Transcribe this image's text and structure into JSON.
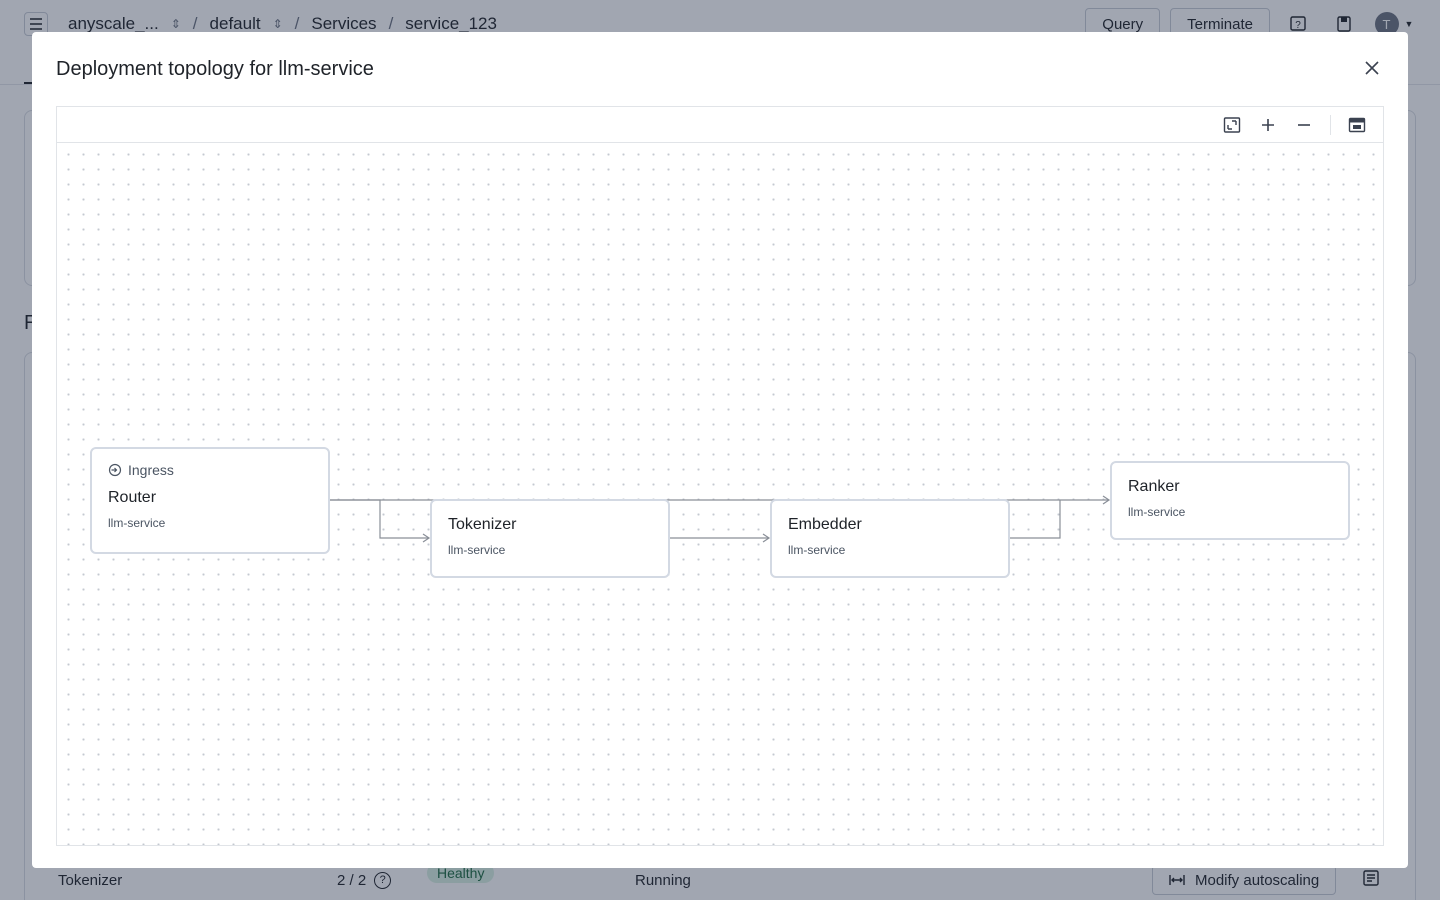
{
  "header": {
    "crumbs": [
      {
        "label": "anyscale_..."
      },
      {
        "label": "default"
      },
      {
        "label": "Services"
      },
      {
        "label": "service_123"
      }
    ],
    "query_label": "Query",
    "terminate_label": "Terminate",
    "avatar_initial": "T"
  },
  "background": {
    "section_letter": "R",
    "row": {
      "name": "Tokenizer",
      "replicas": "2 / 2",
      "help_glyph": "?",
      "health": "Healthy",
      "status": "Running",
      "autoscale_label": "Modify autoscaling"
    }
  },
  "modal": {
    "title": "Deployment topology for llm-service",
    "toolbar": {
      "icons": [
        "fit-view-icon",
        "zoom-in-icon",
        "zoom-out-icon",
        "minimap-toggle-icon"
      ]
    },
    "nodes": [
      {
        "tag": "Ingress",
        "title": "Router",
        "subtitle": "llm-service"
      },
      {
        "title": "Tokenizer",
        "subtitle": "llm-service"
      },
      {
        "title": "Embedder",
        "subtitle": "llm-service"
      },
      {
        "title": "Ranker",
        "subtitle": "llm-service"
      }
    ]
  },
  "colors": {
    "overlay": "#202b44",
    "node_border": "#d3d9e3",
    "edge": "#8a8f98",
    "health_bg": "#d9f2e3",
    "health_text": "#1d6b41"
  }
}
